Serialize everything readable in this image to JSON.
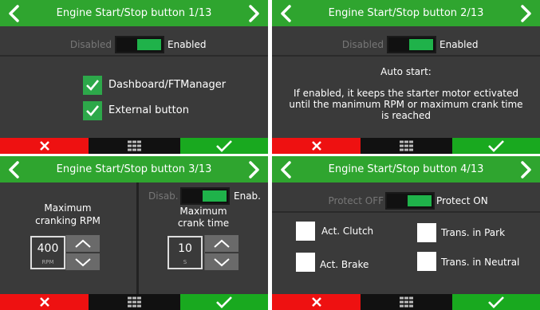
{
  "screens": [
    {
      "title": "Engine Start/Stop button 1/13",
      "toggle": {
        "off_label": "Disabled",
        "on_label": "Enabled",
        "state": "on"
      },
      "options": [
        {
          "label": "Dashboard/FTManager",
          "checked": true
        },
        {
          "label": "External button",
          "checked": true
        }
      ]
    },
    {
      "title": "Engine Start/Stop button 2/13",
      "toggle": {
        "off_label": "Disabled",
        "on_label": "Enabled",
        "state": "on"
      },
      "info_title": "Auto start:",
      "info_line1": "If enabled, it keeps the starter motor ectivated",
      "info_line2": "until the manimum RPM or maximum crank time",
      "info_line3": "is reached"
    },
    {
      "title": "Engine Start/Stop button 3/13",
      "left": {
        "label1": "Maximum",
        "label2": "cranking RPM",
        "value": "400",
        "unit": "RPM"
      },
      "right": {
        "toggle": {
          "off_label": "Disab.",
          "on_label": "Enab.",
          "state": "on"
        },
        "label1": "Maximum",
        "label2": "crank time",
        "value": "10",
        "unit": "S"
      }
    },
    {
      "title": "Engine Start/Stop button 4/13",
      "toggle": {
        "off_label": "Protect OFF",
        "on_label": "Protect ON",
        "state": "on"
      },
      "options": [
        {
          "label": "Act. Clutch",
          "checked": false
        },
        {
          "label": "Trans. in Park",
          "checked": false
        },
        {
          "label": "Act. Brake",
          "checked": false
        },
        {
          "label": "Trans. in Neutral",
          "checked": false
        }
      ]
    }
  ],
  "icons": {
    "prev": "chevron-left-icon",
    "next": "chevron-right-icon",
    "cancel": "x-icon",
    "menu": "grid-icon",
    "confirm": "checkmark-icon",
    "increase": "chevron-up-icon",
    "decrease": "chevron-down-icon"
  },
  "colors": {
    "title_bar": "#2fa52f",
    "panel_bg": "#3a3a3a",
    "cancel": "#ee1111",
    "menu": "#111111",
    "confirm": "#19a91f",
    "toggle_on": "#1fb24a",
    "checkbox_checked": "#2da84a"
  }
}
